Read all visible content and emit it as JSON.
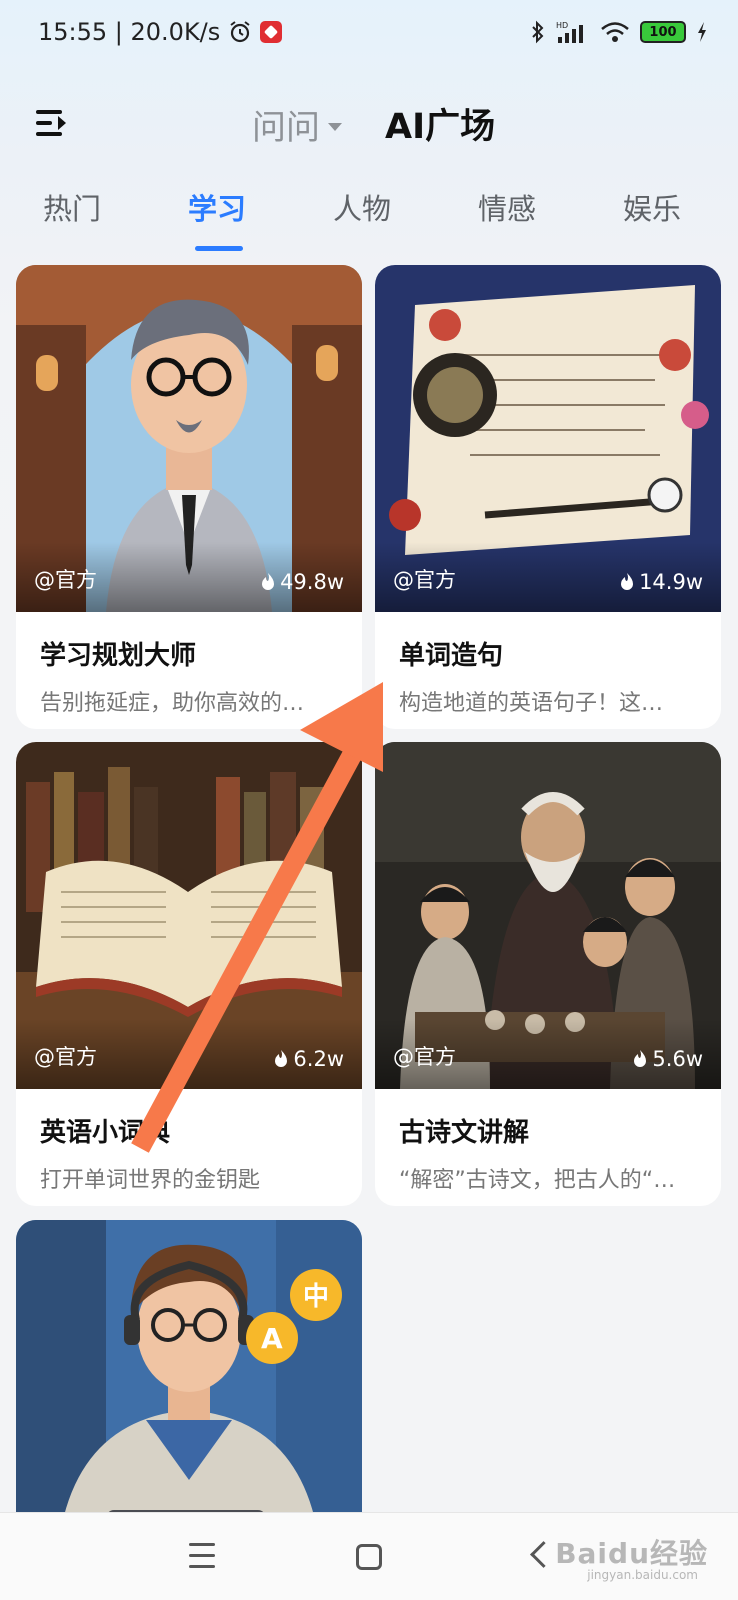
{
  "status_bar": {
    "time_speed": "15:55 | 20.0K/s",
    "battery": "100"
  },
  "header": {
    "switch_label": "问问",
    "title": "AI广场"
  },
  "tabs": [
    {
      "label": "热门"
    },
    {
      "label": "学习"
    },
    {
      "label": "人物"
    },
    {
      "label": "情感"
    },
    {
      "label": "娱乐"
    }
  ],
  "active_tab": "学习",
  "cards": [
    {
      "author": "@官方",
      "heat": "49.8w",
      "title": "学习规划大师",
      "desc": "告别拖延症，助你高效的…"
    },
    {
      "author": "@官方",
      "heat": "14.9w",
      "title": "单词造句",
      "desc": "构造地道的英语句子！这…"
    },
    {
      "author": "@官方",
      "heat": "6.2w",
      "title": "英语小词典",
      "desc": "打开单词世界的金钥匙"
    },
    {
      "author": "@官方",
      "heat": "5.6w",
      "title": "古诗文讲解",
      "desc": "“解密”古诗文，把古人的“…"
    },
    {
      "author": "",
      "heat": "",
      "title": "",
      "desc": ""
    }
  ],
  "watermark": {
    "text": "Baidu经验",
    "sub": "jingyan.baidu.com"
  },
  "colors": {
    "accent": "#2b7cff",
    "annotation_arrow": "#f7794a"
  }
}
